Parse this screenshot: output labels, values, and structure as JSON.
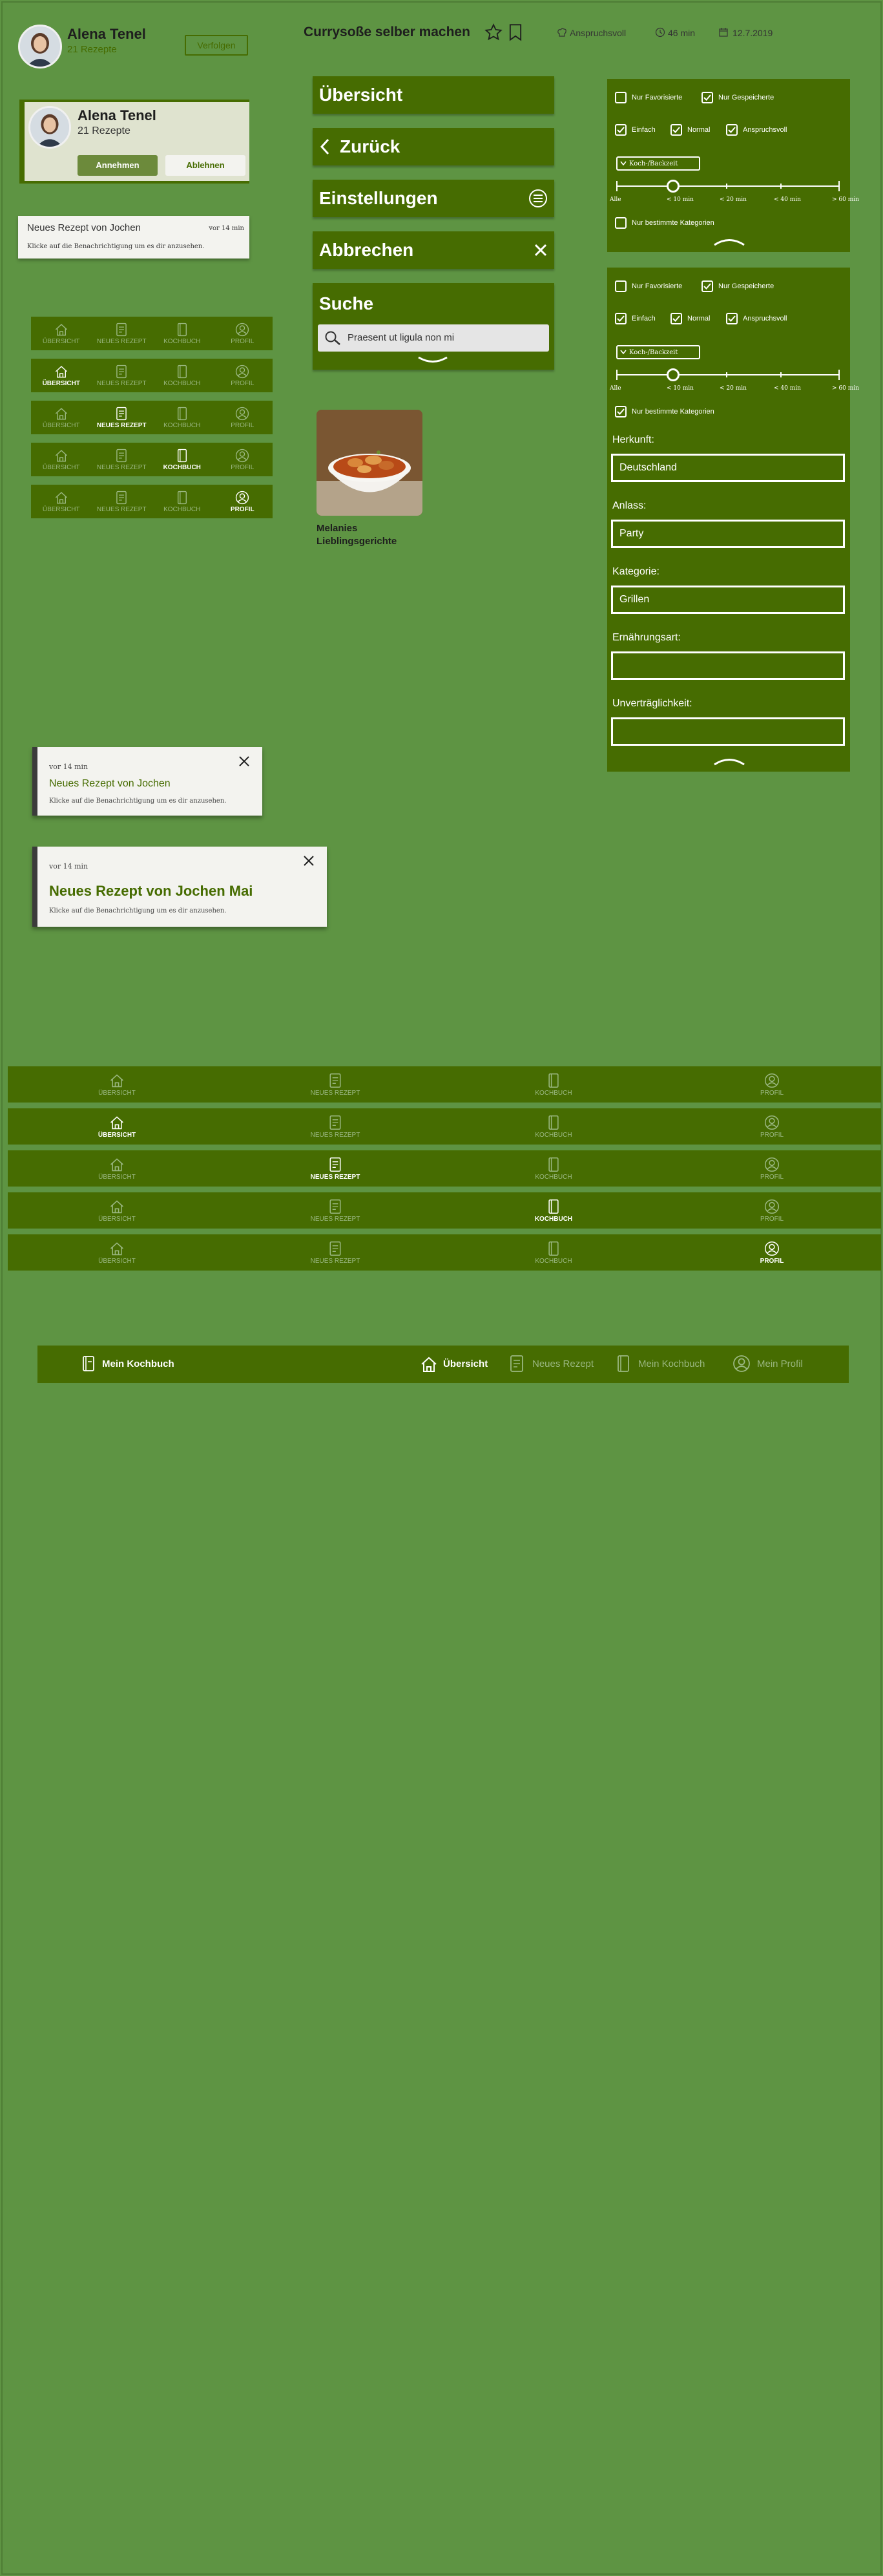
{
  "profile_header": {
    "name": "Alena Tenel",
    "recipes": "21 Rezepte",
    "follow_label": "Verfolgen"
  },
  "recipe_header": {
    "title": "Currysoße selber machen",
    "difficulty": "Anspruchsvoll",
    "duration": "46 min",
    "date": "12.7.2019"
  },
  "friend_request": {
    "name": "Alena Tenel",
    "recipes": "21 Rezepte",
    "accept_label": "Annehmen",
    "decline_label": "Ablehnen"
  },
  "mini_notification": {
    "title": "Neues Rezept von Jochen",
    "time": "vor 14 min",
    "desc": "Klicke auf die Benachrichtigung um es dir anzusehen."
  },
  "menu_buttons": {
    "overview": "Übersicht",
    "back": "Zurück",
    "settings": "Einstellungen",
    "cancel": "Abbrechen",
    "search_title": "Suche",
    "search_placeholder": "Praesent ut ligula non mi"
  },
  "collection_card": {
    "title": "Melanies Lieblingsgerichte"
  },
  "nav_labels": {
    "overview": "Übersicht",
    "new_recipe": "Neues Rezept",
    "cookbook": "Kochbuch",
    "profile": "Profil"
  },
  "filter": {
    "only_favorites": "Nur Favorisierte",
    "only_saved": "Nur Gespeicherte",
    "easy": "Einfach",
    "normal": "Normal",
    "demanding": "Anspruchsvoll",
    "time_dropdown": "Koch-/Backzeit",
    "slider_labels": [
      "Alle",
      "< 10 min",
      "< 20 min",
      "< 40 min",
      "> 60 min"
    ],
    "slider_value": "< 10 min",
    "only_categories": "Nur bestimmte Kategorien",
    "origin_label": "Herkunft:",
    "origin_value": "Deutschland",
    "occasion_label": "Anlass:",
    "occasion_value": "Party",
    "category_label": "Kategorie:",
    "category_value": "Grillen",
    "diet_label": "Ernährungsart:",
    "diet_value": "",
    "intolerance_label": "Unverträglichkeit:",
    "intolerance_value": ""
  },
  "notification_small": {
    "time": "vor 14 min",
    "title": "Neues Rezept von Jochen",
    "desc": "Klicke auf die Benachrichtigung um es dir anzusehen."
  },
  "notification_large": {
    "time": "vor 14 min",
    "title": "Neues Rezept von Jochen Mai",
    "desc": "Klicke auf die Benachrichtigung um es dir anzusehen."
  },
  "desktop_nav": {
    "brand": "Mein Kochbuch",
    "overview": "Übersicht",
    "new_recipe": "Neues Rezept",
    "cookbook": "Mein Kochbuch",
    "profile": "Mein Profil"
  },
  "colors": {
    "page_bg": "#5e9443",
    "primary": "#466c01",
    "inactive": "#9ab781",
    "light": "#f3f3ef"
  },
  "icons": [
    "home-icon",
    "recipe-icon",
    "book-icon",
    "profile-icon",
    "star-icon",
    "bookmark-icon",
    "chef-hat-icon",
    "clock-icon",
    "calendar-icon",
    "chevron-left-icon",
    "settings-icon",
    "close-icon",
    "search-icon",
    "chevron-down-icon",
    "chevron-up-icon",
    "check-icon"
  ]
}
